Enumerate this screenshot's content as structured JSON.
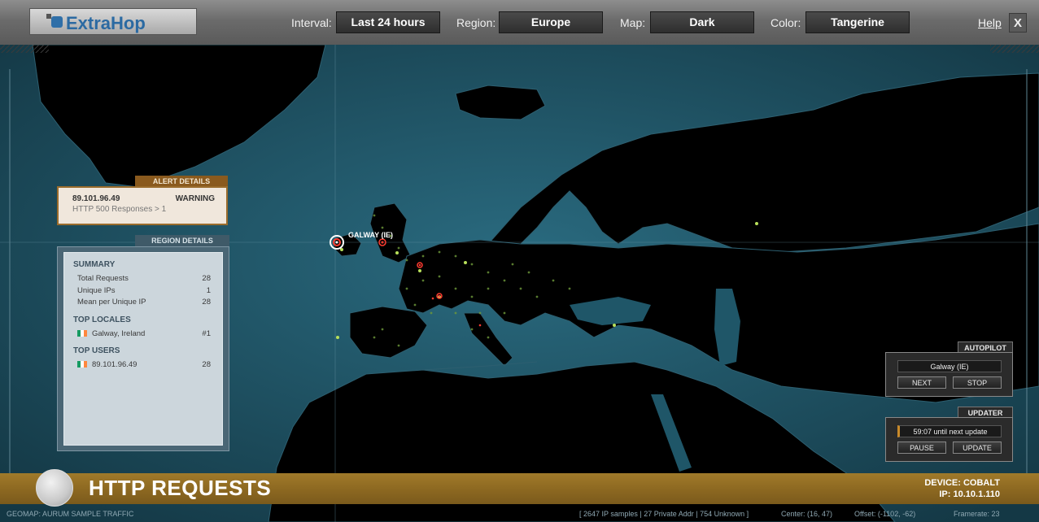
{
  "app": {
    "name": "ExtraHop"
  },
  "controls": {
    "interval_label": "Interval:",
    "interval_value": "Last 24 hours",
    "region_label": "Region:",
    "region_value": "Europe",
    "map_label": "Map:",
    "map_value": "Dark",
    "color_label": "Color:",
    "color_value": "Tangerine",
    "help_label": "Help",
    "close_label": "X"
  },
  "alert": {
    "tab": "ALERT DETAILS",
    "ip": "89.101.96.49",
    "level": "WARNING",
    "message": "HTTP 500 Responses > 1"
  },
  "region": {
    "tab": "REGION DETAILS",
    "summary_title": "SUMMARY",
    "summary": [
      {
        "label": "Total Requests",
        "value": "28"
      },
      {
        "label": "Unique IPs",
        "value": "1"
      },
      {
        "label": "Mean per Unique IP",
        "value": "28"
      }
    ],
    "locales_title": "TOP LOCALES",
    "locales": [
      {
        "label": "Galway, Ireland",
        "value": "#1"
      }
    ],
    "users_title": "TOP USERS",
    "users": [
      {
        "label": "89.101.96.49",
        "value": "28"
      }
    ]
  },
  "map_label": "GALWAY (IE)",
  "autopilot": {
    "tab": "AUTOPILOT",
    "location": "Galway (IE)",
    "next_label": "NEXT",
    "stop_label": "STOP"
  },
  "updater": {
    "tab": "UPDATER",
    "countdown": "59:07 until next update",
    "pause_label": "PAUSE",
    "update_label": "UPDATE"
  },
  "band": {
    "title": "HTTP REQUESTS",
    "device": "DEVICE: COBALT",
    "ip": "IP: 10.10.1.110"
  },
  "status": {
    "left": "GEOMAP: AURUM SAMPLE TRAFFIC",
    "samples": "[ 2647 IP samples | 27 Private Addr | 754 Unknown ]",
    "center": "Center: (16, 47)",
    "offset": "Offset: (-1102, -62)",
    "framerate": "Framerate: 23"
  },
  "colors": {
    "ocean": "#1d4f60",
    "land": "#000000",
    "accent_gold": "#8a6620",
    "alert_border": "#9a6c2c"
  }
}
